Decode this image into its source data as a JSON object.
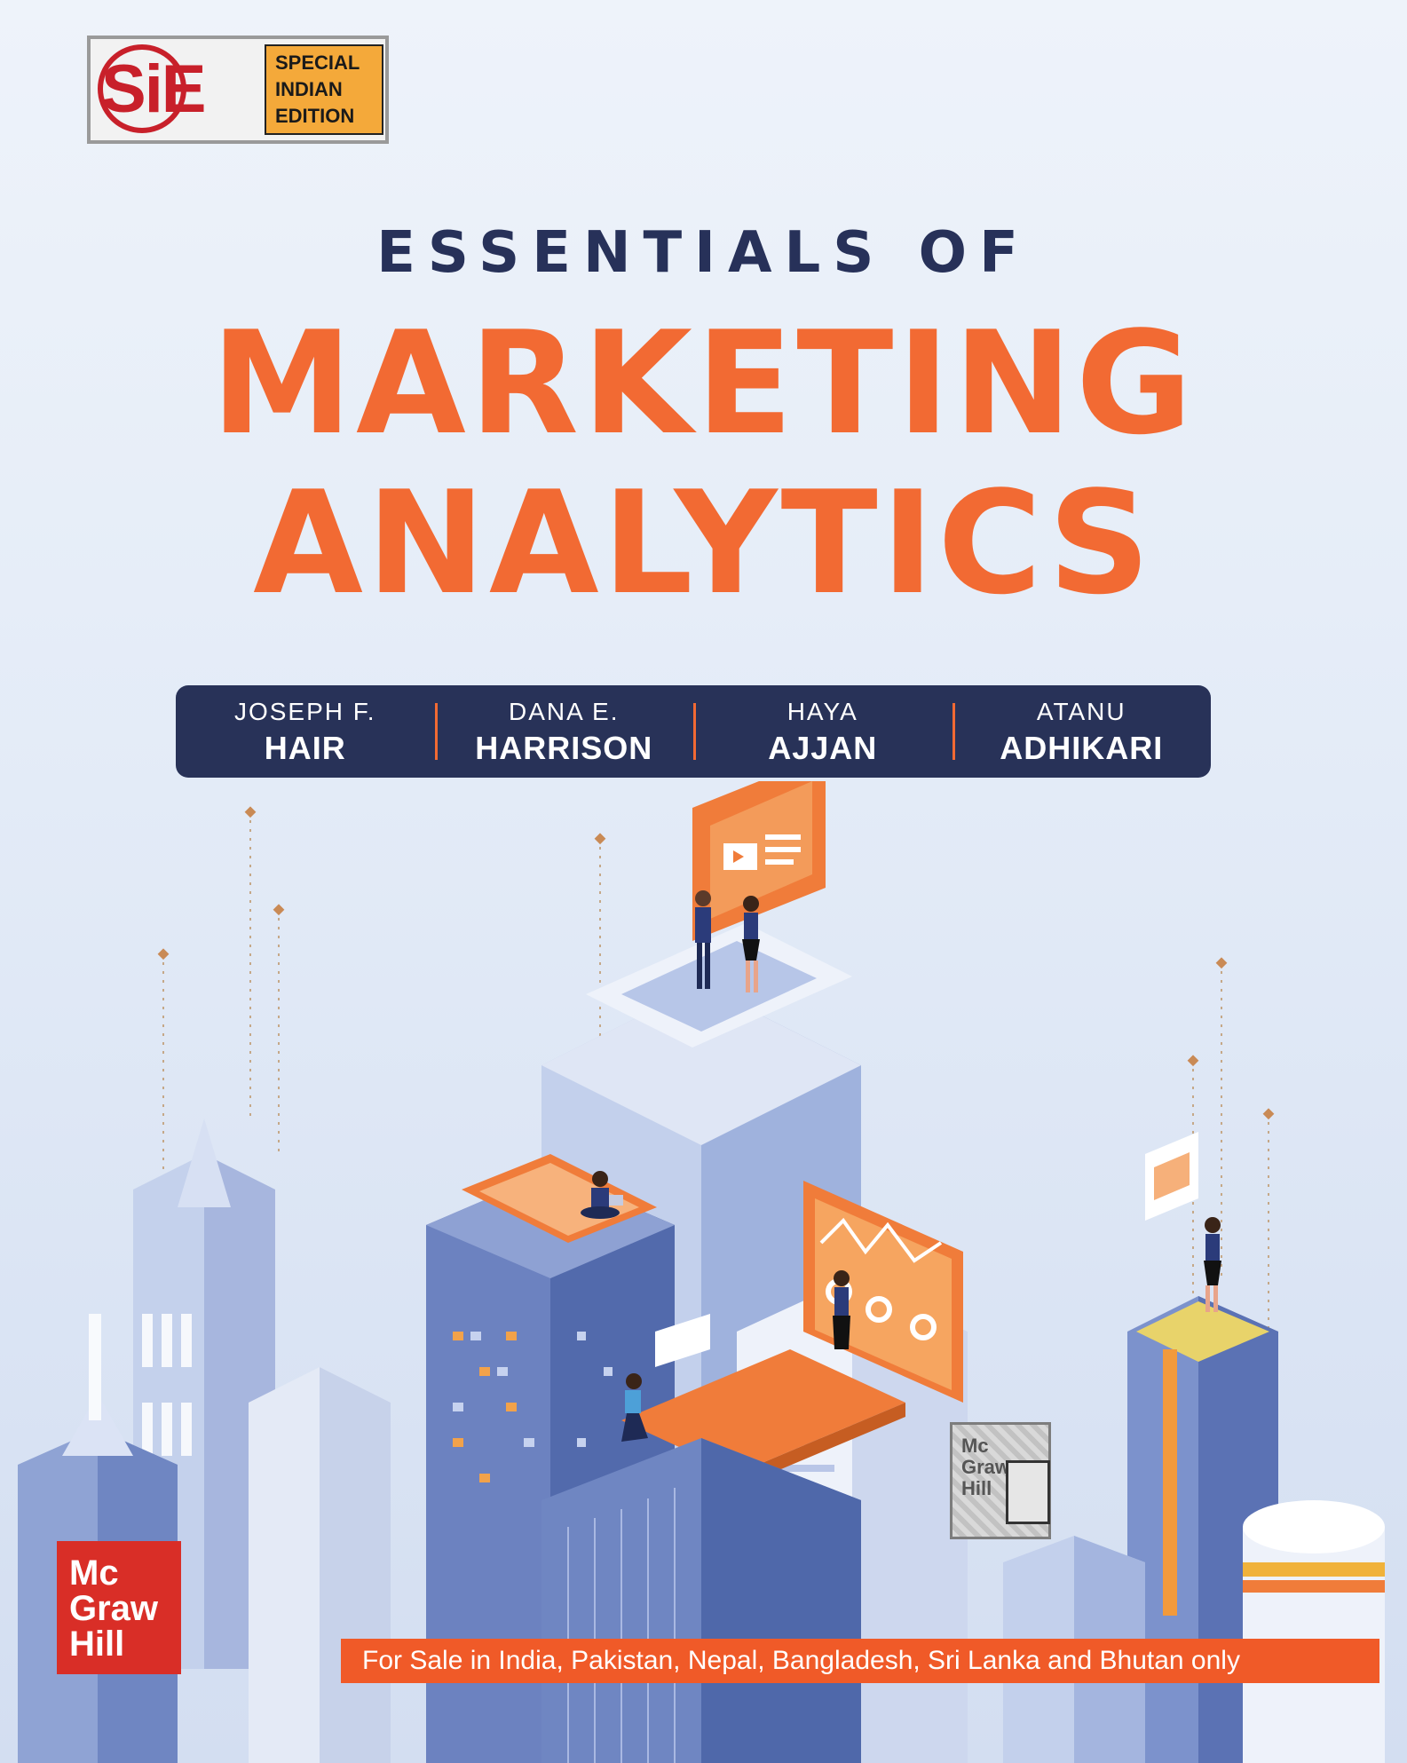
{
  "badge": {
    "lines": [
      "SPECIAL",
      "INDIAN",
      "EDITION"
    ],
    "logo_letters": "SiE"
  },
  "title": {
    "line1": "ESSENTIALS OF",
    "line2": "MARKETING",
    "line3": "ANALYTICS"
  },
  "authors": [
    {
      "first": "JOSEPH F.",
      "last": "HAIR"
    },
    {
      "first": "DANA E.",
      "last": "HARRISON"
    },
    {
      "first": "HAYA",
      "last": "AJJAN"
    },
    {
      "first": "ATANU",
      "last": "ADHIKARI"
    }
  ],
  "publisher": {
    "lines": [
      "Mc",
      "Graw",
      "Hill"
    ]
  },
  "hologram": {
    "lines": [
      "Mc",
      "Graw",
      "Hill"
    ]
  },
  "sale_notice": "For Sale in India, Pakistan, Nepal, Bangladesh, Sri Lanka and Bhutan only",
  "colors": {
    "title_accent": "#f26a33",
    "title_navy": "#273159",
    "author_bar": "#283258",
    "publisher_red": "#d92e27"
  }
}
